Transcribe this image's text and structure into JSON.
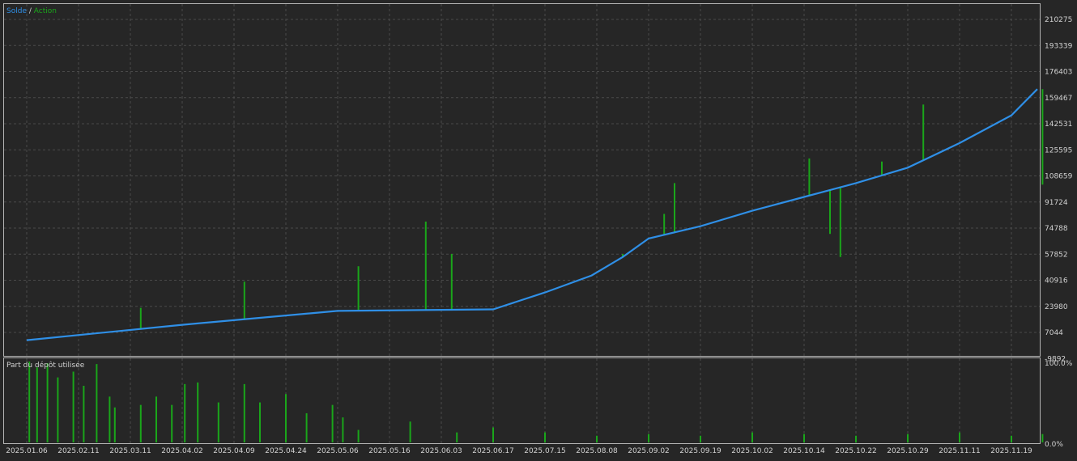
{
  "legend": {
    "balance": "Solde",
    "separator": " / ",
    "equity": "Action"
  },
  "lower_title": "Part du dépôt utilisée",
  "colors": {
    "background": "#262626",
    "frame": "#b4b4b4",
    "grid": "#4a4a4a",
    "balance": "#2f8fe6",
    "equity": "#1aa61a",
    "text": "#d2d2d2"
  },
  "chart_data": [
    {
      "type": "line",
      "title": "",
      "legend": [
        "Solde",
        "Action"
      ],
      "y_ticks": [
        "210275",
        "193339",
        "176403",
        "159467",
        "142531",
        "125595",
        "108659",
        "91724",
        "74788",
        "57852",
        "40916",
        "23980",
        "7044",
        "-9892"
      ],
      "ylim": [
        -9892,
        210275
      ],
      "x_ticks": [
        "2025.01.06",
        "2025.02.11",
        "2025.03.11",
        "2025.04.02",
        "2025.04.09",
        "2025.04.24",
        "2025.05.06",
        "2025.05.16",
        "2025.06.03",
        "2025.06.17",
        "2025.07.15",
        "2025.08.08",
        "2025.09.02",
        "2025.09.19",
        "2025.10.02",
        "2025.10.14",
        "2025.10.22",
        "2025.10.29",
        "2025.11.11",
        "2025.11.19"
      ],
      "grid": true,
      "series": [
        {
          "name": "Solde",
          "x": [
            0,
            3,
            6,
            9,
            10,
            10.9,
            11.5,
            12,
            13,
            14,
            15,
            16,
            17,
            18,
            19,
            19.5
          ],
          "values": [
            2000,
            12000,
            21000,
            22000,
            33000,
            44000,
            56000,
            68000,
            76000,
            86000,
            95000,
            104000,
            114000,
            130000,
            148000,
            165000
          ]
        },
        {
          "name": "Action",
          "x": [
            2.2,
            4.2,
            6.4,
            7.7,
            8.2,
            11.5,
            12.3,
            12.5,
            15.1,
            15.5,
            15.7,
            16.5,
            17.3,
            19.6
          ],
          "values": [
            23000,
            40000,
            50000,
            79000,
            58000,
            58000,
            84000,
            104000,
            120000,
            71000,
            56000,
            118000,
            155000,
            103000
          ]
        }
      ]
    },
    {
      "type": "bar",
      "title": "Part du dépôt utilisée",
      "y_ticks": [
        "100.0%",
        "0.0%"
      ],
      "ylim": [
        0,
        100
      ],
      "x": [
        0.05,
        0.2,
        0.4,
        0.6,
        0.9,
        1.1,
        1.35,
        1.6,
        1.7,
        2.2,
        2.5,
        2.8,
        3.05,
        3.3,
        3.7,
        4.2,
        4.5,
        5.0,
        5.4,
        5.9,
        6.1,
        6.4,
        7.4,
        8.3,
        9.0,
        10.0,
        11.0,
        12.0,
        13.0,
        14.0,
        15.0,
        16.0,
        17.0,
        18.0,
        19.0,
        19.6
      ],
      "values": [
        97,
        90,
        95,
        78,
        85,
        68,
        94,
        55,
        42,
        45,
        55,
        45,
        70,
        72,
        48,
        70,
        48,
        58,
        35,
        45,
        30,
        15,
        25,
        12,
        18,
        12,
        8,
        10,
        8,
        12,
        10,
        8,
        10,
        12,
        8,
        10
      ]
    }
  ]
}
